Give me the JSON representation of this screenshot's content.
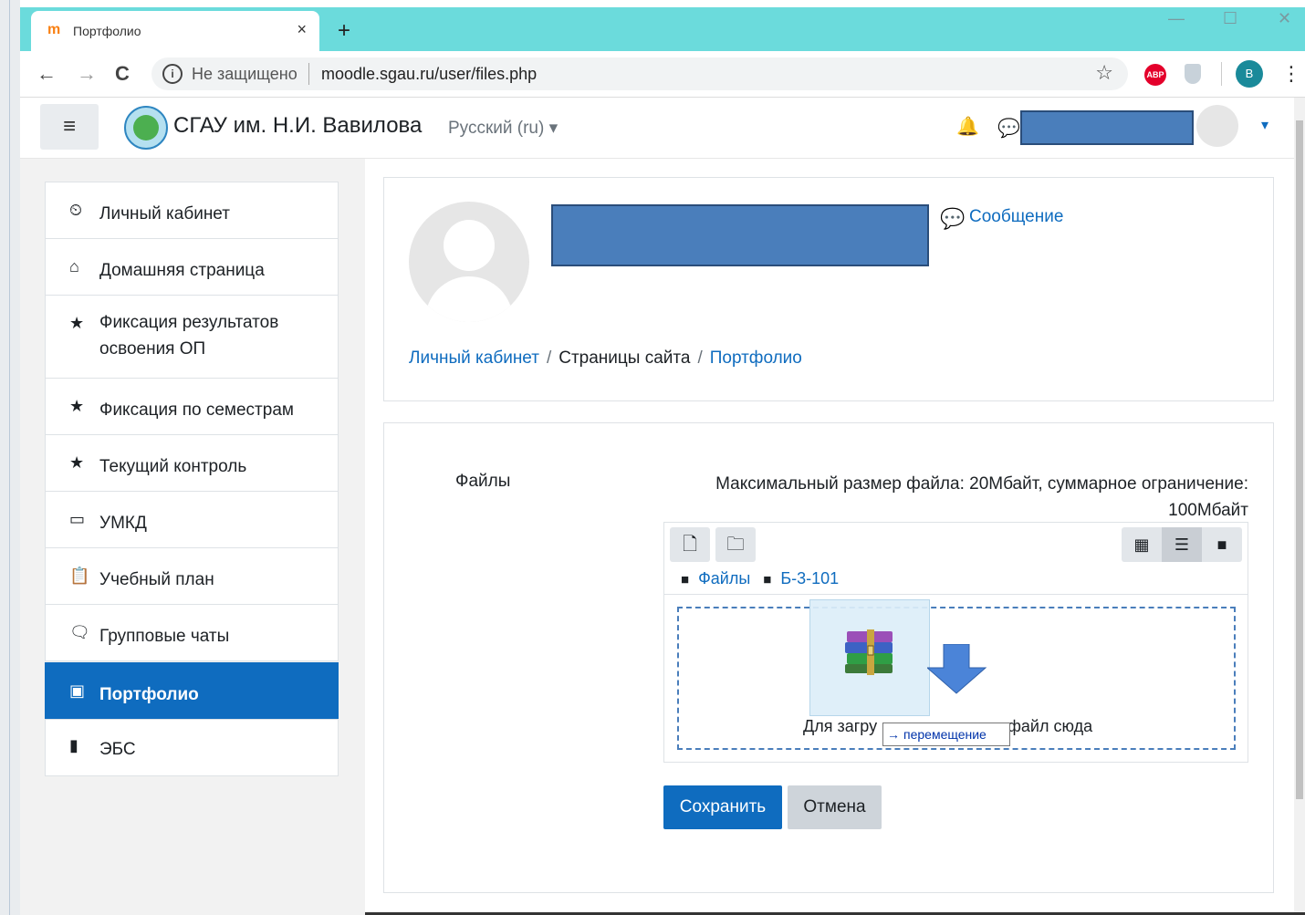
{
  "browser": {
    "tab_title": "Портфолио",
    "tab_favicon": "m",
    "tab_close": "×",
    "new_tab": "+",
    "security_label": "Не защищено",
    "url": "moodle.sgau.ru/user/files.php",
    "profile_initial": "В",
    "abp_label": "ABP",
    "win_minimize": "—",
    "win_maximize": "☐",
    "win_close": "✕",
    "back": "←",
    "forward": "→",
    "reload": "C",
    "star": "☆",
    "menu": "⋮"
  },
  "navbar": {
    "hamburger": "≡",
    "site_name": "СГАУ им. Н.И. Вавилова",
    "language": "Русский (ru) ▾",
    "bell": "🔔",
    "chat": "💬",
    "user_caret": "▾"
  },
  "sidebar": {
    "items": [
      {
        "icon": "⏲",
        "label": "Личный кабинет"
      },
      {
        "icon": "⌂",
        "label": "Домашняя страница"
      },
      {
        "icon": "★",
        "label": "Фиксация результатов освоения ОП"
      },
      {
        "icon": "★",
        "label": "Фиксация по семестрам"
      },
      {
        "icon": "★",
        "label": "Текущий контроль"
      },
      {
        "icon": "▭",
        "label": "УМКД"
      },
      {
        "icon": "📋",
        "label": "Учебный план"
      },
      {
        "icon": "🗨",
        "label": "Групповые чаты"
      },
      {
        "icon": "▣",
        "label": "Портфолио"
      },
      {
        "icon": "▮",
        "label": "ЭБС"
      }
    ],
    "active_index": 8
  },
  "header": {
    "message_icon": "💬",
    "message_link": "Сообщение",
    "breadcrumb": [
      "Личный кабинет",
      "Страницы сайта",
      "Портфолио"
    ],
    "breadcrumb_sep": "/"
  },
  "form": {
    "files_label": "Файлы",
    "limit_text": "Максимальный размер файла: 20Мбайт, суммарное ограничение: 100Мбайт",
    "add_file_icon": "🗋",
    "create_folder_icon": "🗀",
    "view_icons": [
      "▦",
      "☰",
      "■"
    ],
    "path": [
      "Файлы",
      "Б-3-101"
    ],
    "drop_text_left": "Для загру",
    "drop_text_right": " файл сюда",
    "drag_tooltip": "перемещение",
    "drag_tooltip_arrow": "→",
    "save": "Сохранить",
    "cancel": "Отмена"
  },
  "colors": {
    "accent": "#0f6cbf",
    "tabbar": "#6bdbdc",
    "redacted": "#4a7ebb"
  }
}
